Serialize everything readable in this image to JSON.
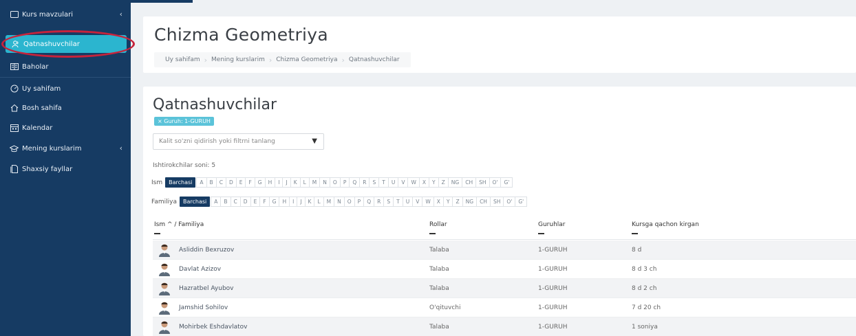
{
  "sidebar": {
    "items": [
      {
        "label": "Kurs mavzulari",
        "icon": "folder-icon",
        "has_chevron": true
      },
      {
        "label": "Qatnashuvchilar",
        "icon": "users-icon",
        "active": true
      },
      {
        "label": "Baholar",
        "icon": "gradebook-icon"
      },
      {
        "label": "Uy sahifam",
        "icon": "dashboard-icon"
      },
      {
        "label": "Bosh sahifa",
        "icon": "home-icon"
      },
      {
        "label": "Kalendar",
        "icon": "calendar-icon"
      },
      {
        "label": "Mening kurslarim",
        "icon": "graduation-cap-icon",
        "has_chevron": true
      },
      {
        "label": "Shaxsiy fayllar",
        "icon": "files-icon"
      }
    ],
    "chevron": "‹"
  },
  "header": {
    "title": "Chizma Geometriya",
    "breadcrumb": [
      "Uy sahifam",
      "Mening kurslarim",
      "Chizma Geometriya",
      "Qatnashuvchilar"
    ]
  },
  "main": {
    "title": "Qatnashuvchilar",
    "filter_badge": "× Guruh: 1-GURUH",
    "search_placeholder": "Kalit so'zni qidirish yoki filtrni tanlang",
    "participants_count": "Ishtirokchilar soni: 5",
    "first_name_label": "Ism",
    "last_name_label": "Familiya",
    "all_label": "Barchasi",
    "letters": [
      "A",
      "B",
      "C",
      "D",
      "E",
      "F",
      "G",
      "H",
      "I",
      "J",
      "K",
      "L",
      "M",
      "N",
      "O",
      "P",
      "Q",
      "R",
      "S",
      "T",
      "U",
      "V",
      "W",
      "X",
      "Y",
      "Z",
      "NG",
      "CH",
      "SH",
      "O'",
      "G'"
    ],
    "columns": {
      "name": "Ism ^ / Familiya",
      "roles": "Rollar",
      "groups": "Guruhlar",
      "joined": "Kursga qachon kirgan"
    },
    "rows": [
      {
        "name": "Asliddin Bexruzov",
        "role": "Talaba",
        "group": "1-GURUH",
        "since": "8 d"
      },
      {
        "name": "Davlat Azizov",
        "role": "Talaba",
        "group": "1-GURUH",
        "since": "8 d 3 ch"
      },
      {
        "name": "Hazratbel Ayubov",
        "role": "Talaba",
        "group": "1-GURUH",
        "since": "8 d 2 ch"
      },
      {
        "name": "Jamshid Sohilov",
        "role": "O'qituvchi",
        "group": "1-GURUH",
        "since": "7 d 20 ch"
      },
      {
        "name": "Mohirbek Eshdavlatov",
        "role": "Talaba",
        "group": "1-GURUH",
        "since": "1 soniya"
      }
    ]
  },
  "colors": {
    "sidebar_bg": "#163b63",
    "active_item": "#2bb5cf",
    "highlight_oval": "#c7233b",
    "badge": "#5bc3d9"
  }
}
